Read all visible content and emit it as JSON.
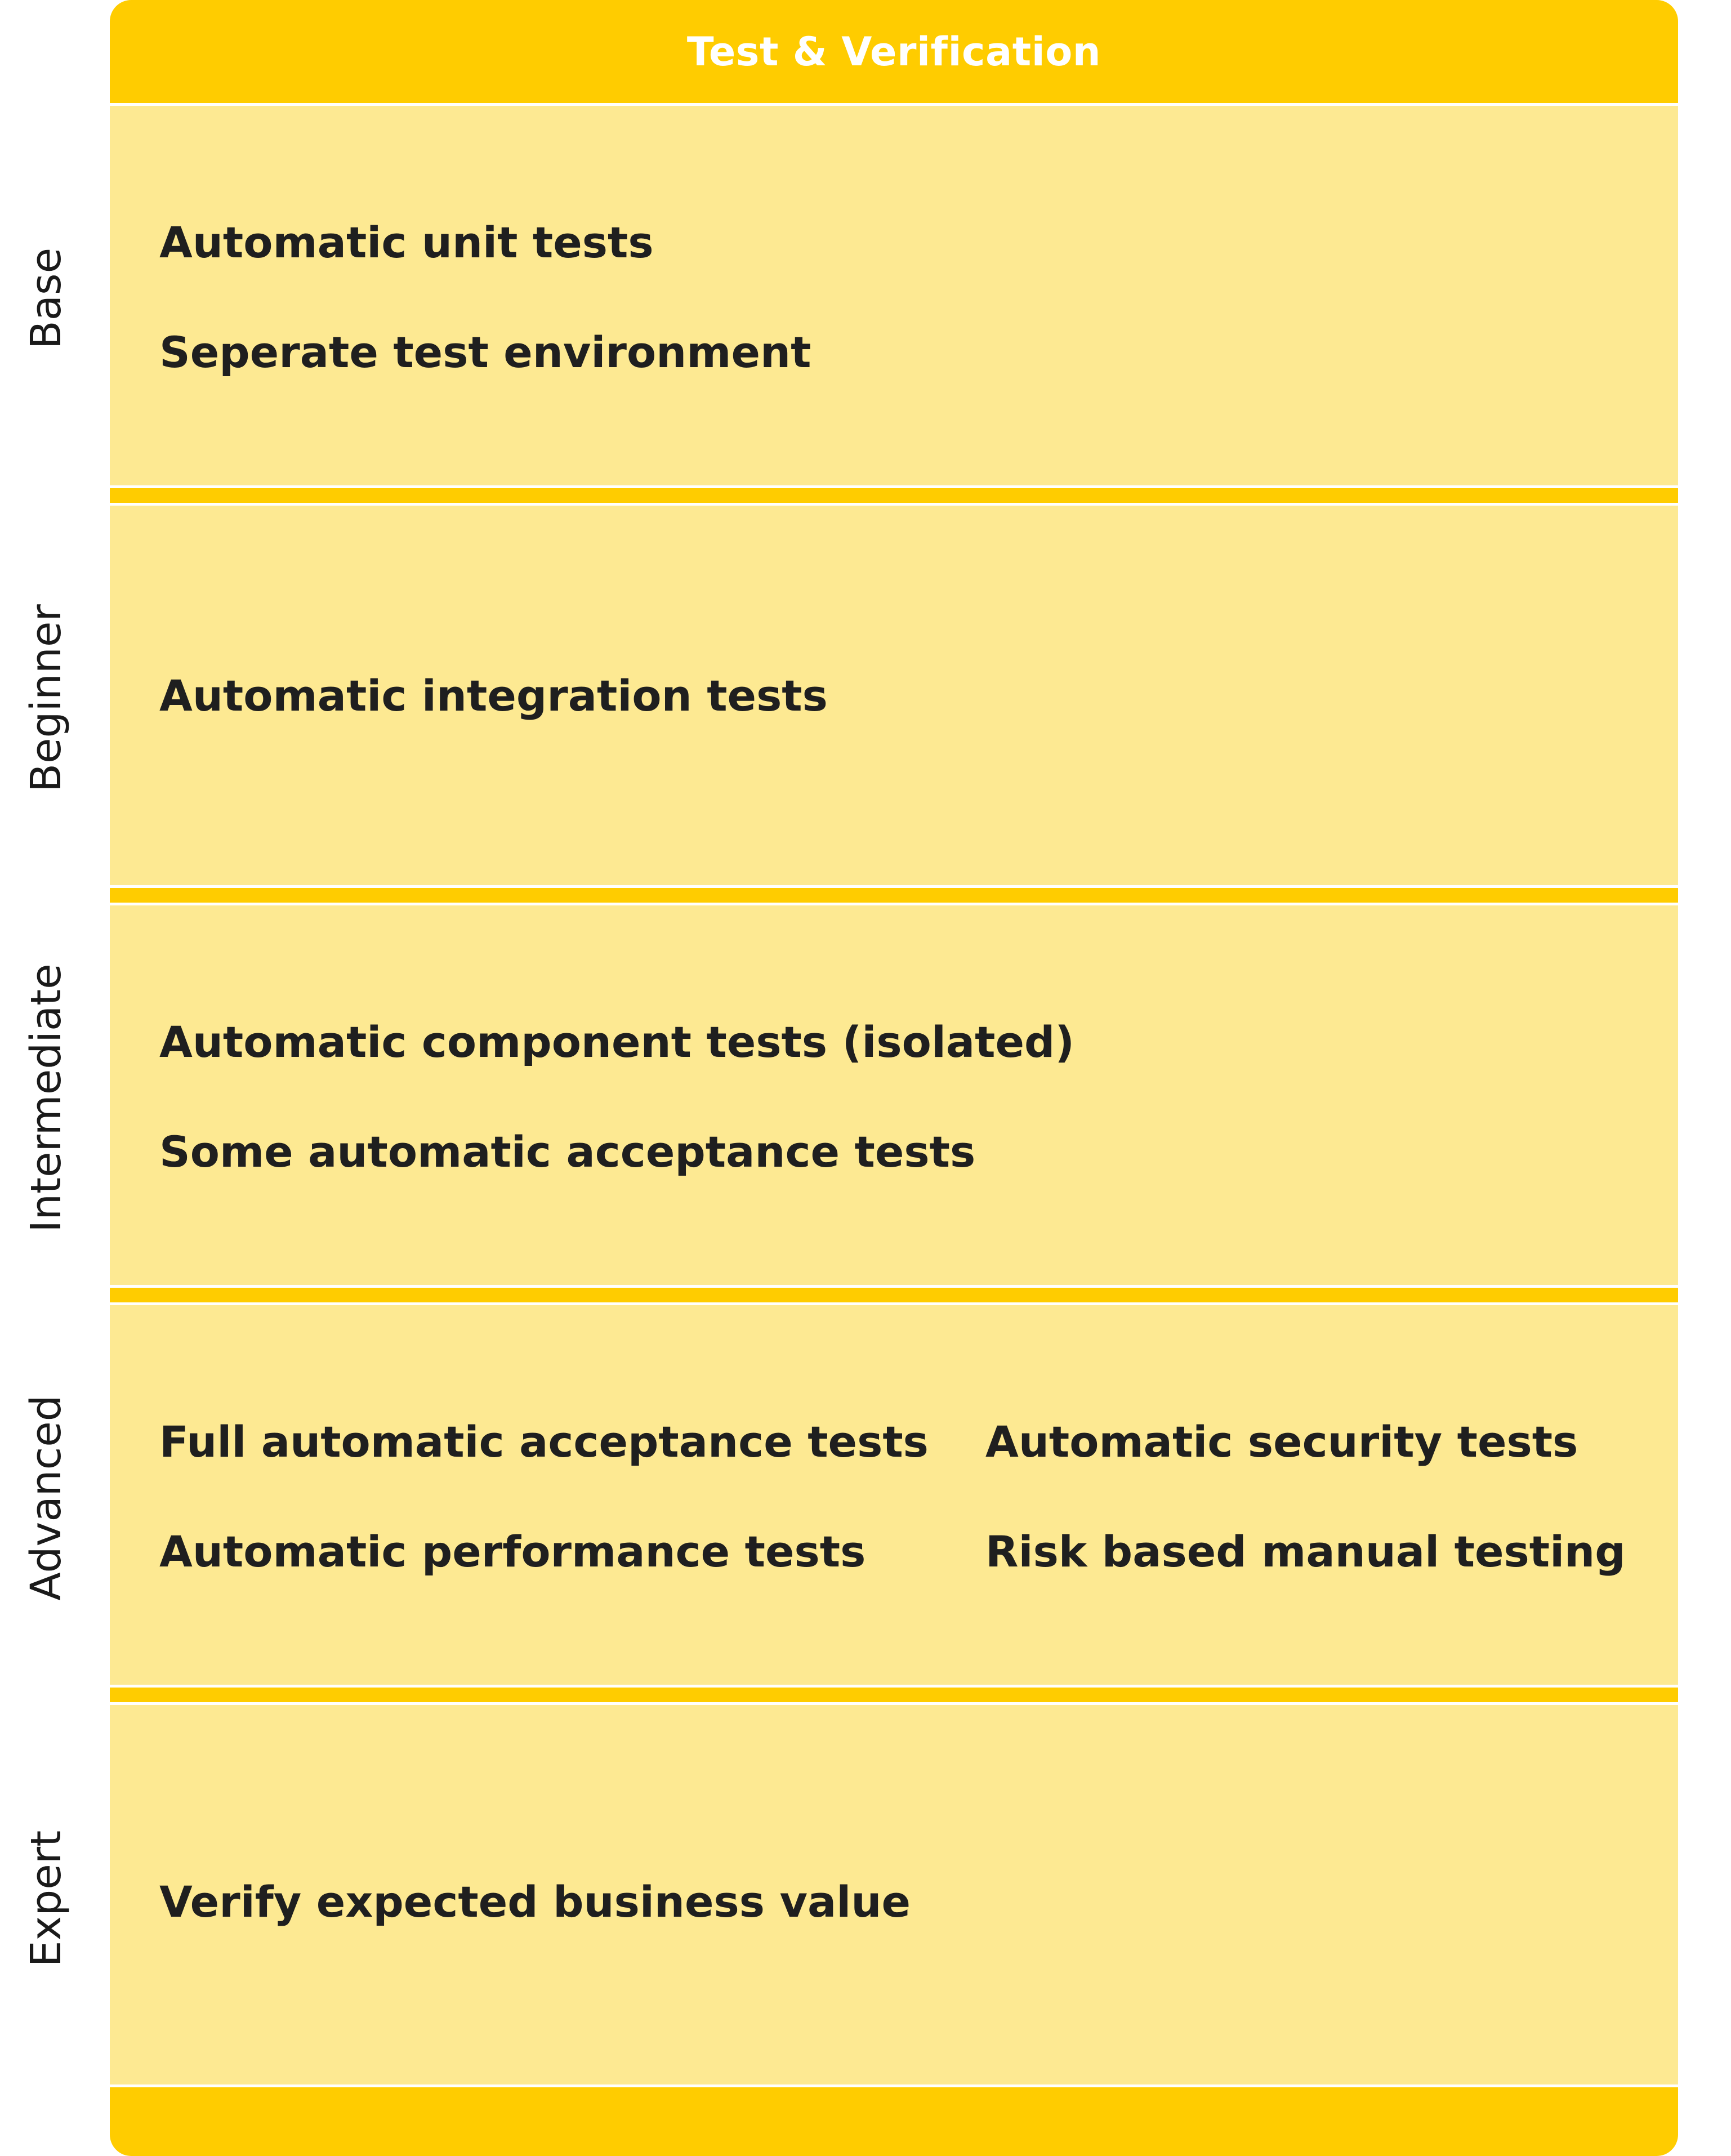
{
  "header": {
    "title": "Test & Verification"
  },
  "levels": [
    {
      "label": "Base",
      "practices": [
        "Automatic unit tests",
        "Seperate test environment"
      ]
    },
    {
      "label": "Beginner",
      "practices": [
        "Automatic integration tests"
      ]
    },
    {
      "label": "Intermediate",
      "practices": [
        "Automatic component tests (isolated)",
        "Some automatic acceptance tests"
      ]
    },
    {
      "label": "Advanced",
      "practices": [
        "Full automatic acceptance tests",
        "Automatic performance tests",
        "Automatic security tests",
        "Risk based manual testing"
      ]
    },
    {
      "label": "Expert",
      "practices": [
        "Verify expected business value"
      ]
    }
  ],
  "colors": {
    "accent": "#FFCC00",
    "row_background": "#FDE992",
    "text": "#1f1f1f",
    "header_text": "#ffffff"
  }
}
